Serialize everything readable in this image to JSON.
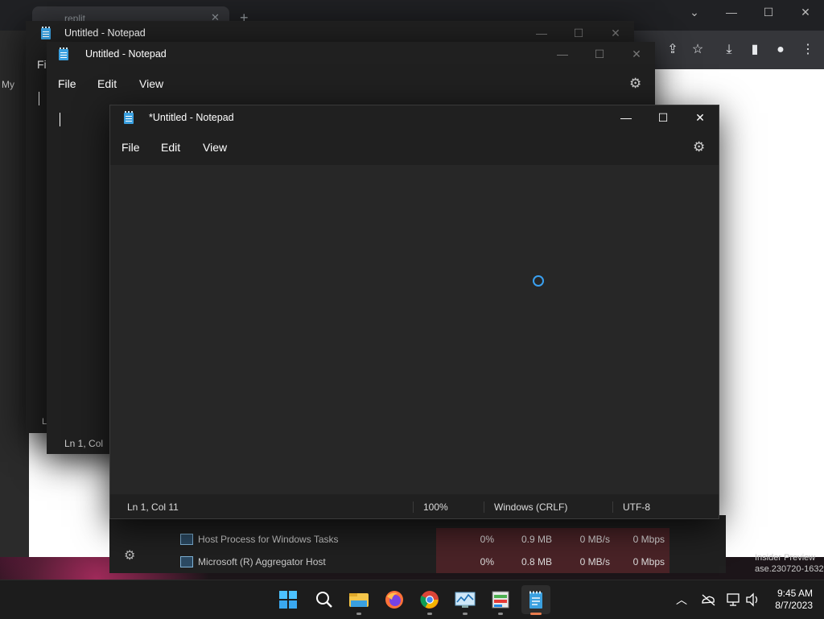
{
  "browser": {
    "tab_title": "replit",
    "tab_close": "✕",
    "new_tab": "+",
    "side_text": "My",
    "win_min": "—",
    "win_max": "☐",
    "win_close": "✕",
    "dropdown": "⌄"
  },
  "notepad_back": {
    "title": "Untitled - Notepad",
    "side_menu": "Fi",
    "status_partial": "L"
  },
  "notepad_mid": {
    "title": "Untitled - Notepad",
    "menu": [
      "File",
      "Edit",
      "View"
    ],
    "status_ln": "Ln 1, Col"
  },
  "notepad_front": {
    "title": "*Untitled - Notepad",
    "menu": [
      "File",
      "Edit",
      "View"
    ],
    "status": {
      "position": "Ln 1, Col 11",
      "zoom": "100%",
      "line_ending": "Windows (CRLF)",
      "encoding": "UTF-8"
    },
    "win_min": "—",
    "win_max": "☐",
    "win_close": "✕"
  },
  "task_manager": {
    "rows": [
      {
        "name": "Host Process for Windows Tasks",
        "cpu": "0%",
        "memory": "0.9 MB",
        "disk": "0 MB/s",
        "network": "0 Mbps"
      },
      {
        "name": "Microsoft (R) Aggregator Host",
        "cpu": "0%",
        "memory": "0.8 MB",
        "disk": "0 MB/s",
        "network": "0 Mbps"
      }
    ],
    "watermark_line1": "Insider Preview",
    "watermark_line2": "ase.230720-1632"
  },
  "taskbar": {
    "apps": [
      "start-icon",
      "search-icon",
      "file-explorer-icon",
      "firefox-icon",
      "chrome-icon",
      "performance-monitor-icon",
      "task-manager-icon",
      "notepad-icon"
    ],
    "time": "9:45 AM",
    "date": "8/7/2023"
  }
}
